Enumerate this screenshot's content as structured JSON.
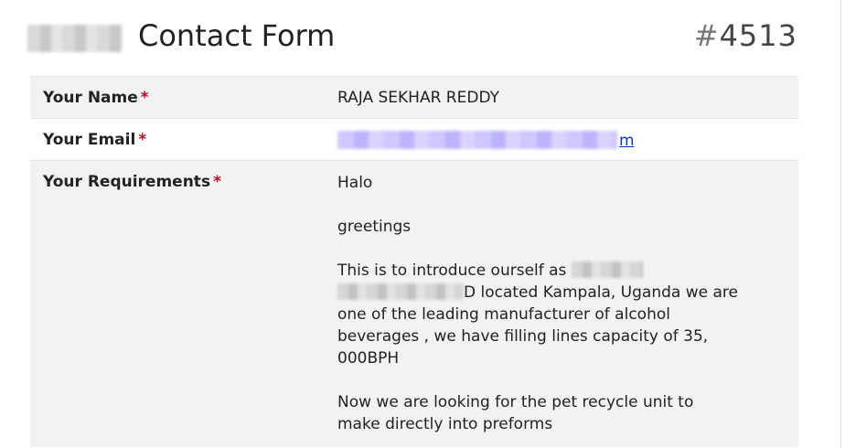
{
  "header": {
    "form_title": "Contact Form",
    "entry_hash": "#",
    "entry_number": "4513"
  },
  "fields": {
    "name": {
      "label": "Your Name",
      "required_marker": "*",
      "value": "RAJA SEKHAR REDDY"
    },
    "email": {
      "label": "Your Email",
      "required_marker": "*",
      "visible_tail": "m"
    },
    "requirements": {
      "label": "Your Requirements",
      "required_marker": "*",
      "paragraphs": {
        "p1": "Halo",
        "p2": "greetings",
        "p3_start": "This is to introduce ourself as",
        "p3_rest": "D located Kampala, Uganda we are one of the leading manufacturer of alcohol beverages , we have filling lines capacity of 35, 000BPH",
        "p4": "Now we are looking for the pet recycle unit to make directly into preforms"
      }
    }
  },
  "colors": {
    "required": "#d0021b",
    "link": "#0b38c8",
    "row_shade": "#f2f2f2"
  }
}
